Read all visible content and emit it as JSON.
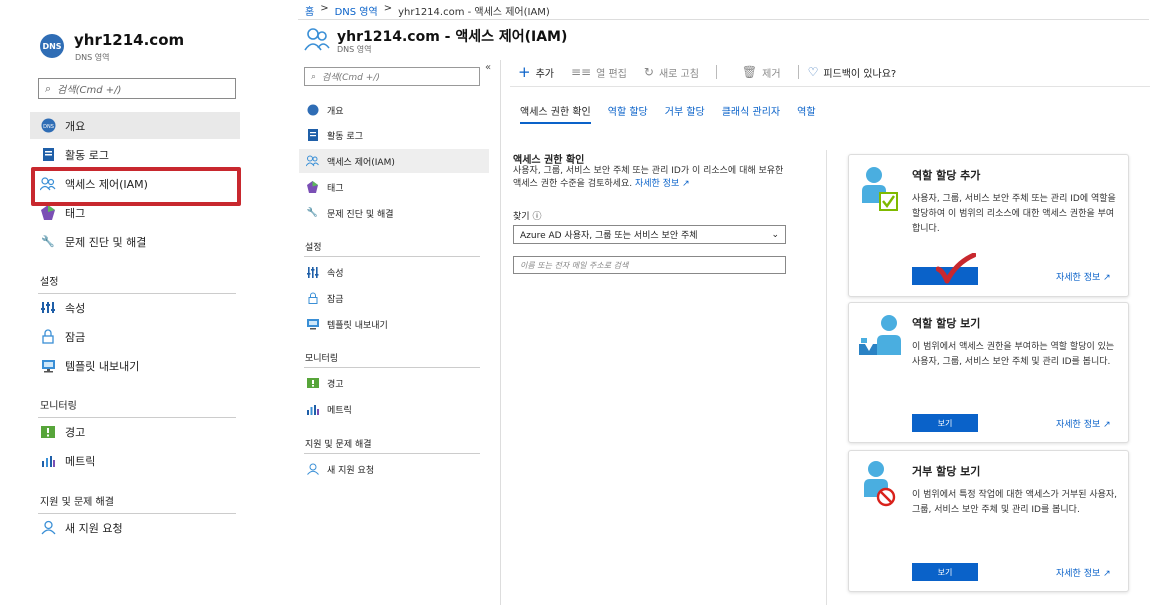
{
  "left_blade": {
    "badge": "DNS",
    "title": "yhr1214.com",
    "subtitle": "DNS 영역",
    "search_placeholder": "검색(Cmd +/)",
    "nav": [
      {
        "label": "개요",
        "icon": "overview-icon"
      },
      {
        "label": "활동 로그",
        "icon": "activity-log-icon"
      },
      {
        "label": "액세스 제어(IAM)",
        "icon": "iam-icon"
      },
      {
        "label": "태그",
        "icon": "tag-icon"
      },
      {
        "label": "문제 진단 및 해결",
        "icon": "wrench-icon"
      }
    ],
    "sections": [
      {
        "title": "설정",
        "items": [
          {
            "label": "속성",
            "icon": "properties-icon"
          },
          {
            "label": "잠금",
            "icon": "lock-icon"
          },
          {
            "label": "템플릿 내보내기",
            "icon": "export-template-icon"
          }
        ]
      },
      {
        "title": "모니터링",
        "items": [
          {
            "label": "경고",
            "icon": "alert-icon"
          },
          {
            "label": "메트릭",
            "icon": "metrics-icon"
          }
        ]
      },
      {
        "title": "지원 및 문제 해결",
        "items": [
          {
            "label": "새 지원 요청",
            "icon": "support-icon"
          }
        ]
      }
    ]
  },
  "breadcrumb": [
    "홈",
    "DNS 영역",
    "yhr1214.com - 액세스 제어(IAM)"
  ],
  "header": {
    "title": "yhr1214.com - 액세스 제어(IAM)",
    "subtitle": "DNS 영역"
  },
  "middle_menu": {
    "search_placeholder": "검색(Cmd +/)",
    "collapse": "«",
    "nav": [
      {
        "label": "개요",
        "icon": "overview-icon"
      },
      {
        "label": "활동 로그",
        "icon": "activity-log-icon"
      },
      {
        "label": "액세스 제어(IAM)",
        "icon": "iam-icon"
      },
      {
        "label": "태그",
        "icon": "tag-icon"
      },
      {
        "label": "문제 진단 및 해결",
        "icon": "wrench-icon"
      }
    ],
    "sections": [
      {
        "title": "설정",
        "items": [
          {
            "label": "속성",
            "icon": "properties-icon"
          },
          {
            "label": "잠금",
            "icon": "lock-icon"
          },
          {
            "label": "템플릿 내보내기",
            "icon": "export-template-icon"
          }
        ]
      },
      {
        "title": "모니터링",
        "items": [
          {
            "label": "경고",
            "icon": "alert-icon"
          },
          {
            "label": "메트릭",
            "icon": "metrics-icon"
          }
        ]
      },
      {
        "title": "지원 및 문제 해결",
        "items": [
          {
            "label": "새 지원 요청",
            "icon": "support-icon"
          }
        ]
      }
    ]
  },
  "toolbar": {
    "add": "추가",
    "edit_columns": "열 편집",
    "refresh": "새로 고침",
    "remove": "제거",
    "feedback": "피드백이 있나요?"
  },
  "tabs": [
    "액세스 권한 확인",
    "역할 할당",
    "거부 할당",
    "클래식 관리자",
    "역할"
  ],
  "check_access": {
    "title": "액세스 권한 확인",
    "desc": "사용자, 그룹, 서비스 보안 주체 또는 관리 ID가 이 리소스에 대해 보유한 액세스 권한 수준을 검토하세요.",
    "learn_more": "자세한 정보",
    "find_label": "찾기",
    "find_select": "Azure AD 사용자, 그룹 또는 서비스 보안 주체",
    "find_placeholder": "이름 또는 전자 메일 주소로 검색"
  },
  "cards": [
    {
      "title": "역할 할당 추가",
      "desc": "사용자, 그룹, 서비스 보안 주체 또는 관리 ID에 역할을 할당하여 이 범위의 리소스에 대한 액세스 권한을 부여합니다.",
      "button": "",
      "link": "자세한 정보"
    },
    {
      "title": "역할 할당 보기",
      "desc": "이 범위에서 액세스 권한을 부여하는 역할 할당이 있는 사용자, 그룹, 서비스 보안 주체 및 관리 ID를 봅니다.",
      "button": "보기",
      "link": "자세한 정보"
    },
    {
      "title": "거부 할당 보기",
      "desc": "이 범위에서 특정 작업에 대한 액세스가 거부된 사용자, 그룹, 서비스 보안 주체 및 관리 ID를 봅니다.",
      "button": "보기",
      "link": "자세한 정보"
    }
  ],
  "colors": {
    "accent": "#0a62c9",
    "highlight": "#c8282e",
    "icon_blue": "#4aaee0"
  }
}
